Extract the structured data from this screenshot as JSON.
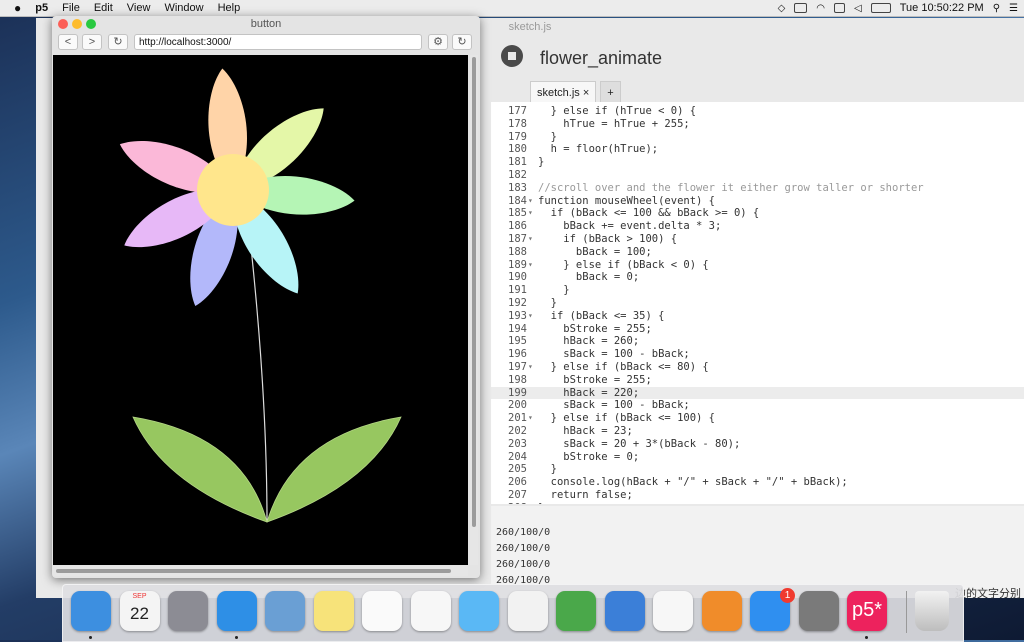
{
  "menubar": {
    "apple": "",
    "items": [
      "p5",
      "File",
      "Edit",
      "View",
      "Window",
      "Help"
    ],
    "clock": "Tue 10:50:22 PM"
  },
  "editor": {
    "window_title": "sketch.js",
    "sketch_name": "flower_animate",
    "tabs": [
      "sketch.js ×",
      "+"
    ],
    "code_lines": [
      {
        "n": "177",
        "f": "",
        "t": "  } else if (hTrue < 0) {",
        "hl": false
      },
      {
        "n": "178",
        "f": "",
        "t": "    hTrue = hTrue + 255;",
        "hl": false
      },
      {
        "n": "179",
        "f": "",
        "t": "  }",
        "hl": false
      },
      {
        "n": "180",
        "f": "",
        "t": "  h = floor(hTrue);",
        "hl": false
      },
      {
        "n": "181",
        "f": "",
        "t": "}",
        "hl": false
      },
      {
        "n": "182",
        "f": "",
        "t": "",
        "hl": false
      },
      {
        "n": "183",
        "f": "",
        "t": "//scroll over and the flower it either grow taller or shorter",
        "hl": false
      },
      {
        "n": "184",
        "f": "▾",
        "t": "function mouseWheel(event) {",
        "hl": false
      },
      {
        "n": "185",
        "f": "▾",
        "t": "  if (bBack <= 100 && bBack >= 0) {",
        "hl": false
      },
      {
        "n": "186",
        "f": "",
        "t": "    bBack += event.delta * 3;",
        "hl": false
      },
      {
        "n": "187",
        "f": "▾",
        "t": "    if (bBack > 100) {",
        "hl": false
      },
      {
        "n": "188",
        "f": "",
        "t": "      bBack = 100;",
        "hl": false
      },
      {
        "n": "189",
        "f": "▾",
        "t": "    } else if (bBack < 0) {",
        "hl": false
      },
      {
        "n": "190",
        "f": "",
        "t": "      bBack = 0;",
        "hl": false
      },
      {
        "n": "191",
        "f": "",
        "t": "    }",
        "hl": false
      },
      {
        "n": "192",
        "f": "",
        "t": "  }",
        "hl": false
      },
      {
        "n": "193",
        "f": "▾",
        "t": "  if (bBack <= 35) {",
        "hl": false
      },
      {
        "n": "194",
        "f": "",
        "t": "    bStroke = 255;",
        "hl": false
      },
      {
        "n": "195",
        "f": "",
        "t": "    hBack = 260;",
        "hl": false
      },
      {
        "n": "196",
        "f": "",
        "t": "    sBack = 100 - bBack;",
        "hl": false
      },
      {
        "n": "197",
        "f": "▾",
        "t": "  } else if (bBack <= 80) {",
        "hl": false
      },
      {
        "n": "198",
        "f": "",
        "t": "    bStroke = 255;",
        "hl": false
      },
      {
        "n": "199",
        "f": "",
        "t": "    hBack = 220;",
        "hl": true
      },
      {
        "n": "200",
        "f": "",
        "t": "    sBack = 100 - bBack;",
        "hl": false
      },
      {
        "n": "201",
        "f": "▾",
        "t": "  } else if (bBack <= 100) {",
        "hl": false
      },
      {
        "n": "202",
        "f": "",
        "t": "    hBack = 23;",
        "hl": false
      },
      {
        "n": "203",
        "f": "",
        "t": "    sBack = 20 + 3*(bBack - 80);",
        "hl": false
      },
      {
        "n": "204",
        "f": "",
        "t": "    bStroke = 0;",
        "hl": false
      },
      {
        "n": "205",
        "f": "",
        "t": "  }",
        "hl": false
      },
      {
        "n": "206",
        "f": "",
        "t": "  console.log(hBack + \"/\" + sBack + \"/\" + bBack);",
        "hl": false
      },
      {
        "n": "207",
        "f": "",
        "t": "  return false;",
        "hl": false
      },
      {
        "n": "208",
        "f": "",
        "t": "}",
        "hl": false
      }
    ],
    "console_lines": [
      "260/100/0",
      "260/100/0",
      "260/100/0",
      "260/100/0"
    ]
  },
  "browser": {
    "title": "button",
    "url": "http://localhost:3000/",
    "back_label": "<",
    "forward_label": ">",
    "reload_label": "↻",
    "settings_label": "⚙",
    "refresh_label": "↻"
  },
  "dock": {
    "apps": [
      {
        "name": "Finder",
        "color": "#3d8fe0",
        "running": true
      },
      {
        "name": "Calendar",
        "color": "#f4f4f4",
        "running": false,
        "label": "22",
        "sub": "SEP"
      },
      {
        "name": "Launchpad",
        "color": "#8c8c94",
        "running": false
      },
      {
        "name": "Safari",
        "color": "#2e8fe6",
        "running": true
      },
      {
        "name": "Preview",
        "color": "#6a9fd4",
        "running": false
      },
      {
        "name": "Notes",
        "color": "#f7e37a",
        "running": false
      },
      {
        "name": "Reminders",
        "color": "#fafafa",
        "running": false
      },
      {
        "name": "Photos",
        "color": "#f7f7f7",
        "running": false
      },
      {
        "name": "Messages",
        "color": "#5ab8f5",
        "running": false
      },
      {
        "name": "TextEdit",
        "color": "#f2f2f2",
        "running": false
      },
      {
        "name": "Numbers",
        "color": "#4aa84a",
        "running": false
      },
      {
        "name": "Keynote",
        "color": "#3b7fd8",
        "running": false
      },
      {
        "name": "iTunes",
        "color": "#f7f7f7",
        "running": false
      },
      {
        "name": "iBooks",
        "color": "#f08c2a",
        "running": false
      },
      {
        "name": "App Store",
        "color": "#2f8ff0",
        "running": false,
        "badge": "1"
      },
      {
        "name": "System Preferences",
        "color": "#7a7a7a",
        "running": false
      },
      {
        "name": "p5",
        "color": "#ed225d",
        "running": true,
        "label": "p5*"
      }
    ],
    "trash": "Trash",
    "behind_text": "边的文字分别"
  },
  "colors": {
    "petal_peach": "#ffd4a8",
    "petal_lime": "#e4f7a8",
    "petal_mint": "#b5f5b5",
    "petal_cyan": "#b7f4f7",
    "petal_blue": "#b3b8fa",
    "petal_violet": "#e7b8f7",
    "petal_pink": "#fbb8d8",
    "center": "#ffe68c",
    "leaf": "#97c760"
  }
}
